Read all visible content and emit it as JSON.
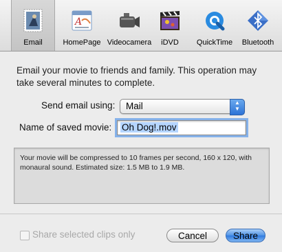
{
  "toolbar": {
    "items": [
      {
        "label": "Email",
        "icon": "email-stamp-icon",
        "selected": true
      },
      {
        "label": "HomePage",
        "icon": "homepage-icon",
        "selected": false
      },
      {
        "label": "Videocamera",
        "icon": "videocamera-icon",
        "selected": false
      },
      {
        "label": "iDVD",
        "icon": "idvd-clapboard-icon",
        "selected": false
      },
      {
        "label": "QuickTime",
        "icon": "quicktime-icon",
        "selected": false
      },
      {
        "label": "Bluetooth",
        "icon": "bluetooth-icon",
        "selected": false
      }
    ]
  },
  "main": {
    "description": "Email your movie to friends and family. This operation may take several minutes to complete.",
    "send_label": "Send email using:",
    "send_value": "Mail",
    "name_label": "Name of saved movie:",
    "name_value": "Oh Dog!.mov",
    "info": "Your movie will be compressed to 10 frames per second, 160 x 120, with monaural sound. Estimated size: 1.5 MB to 1.9 MB."
  },
  "footer": {
    "share_clips_label": "Share selected clips only",
    "share_clips_checked": false,
    "cancel_label": "Cancel",
    "share_label": "Share"
  },
  "colors": {
    "accent": "#4f93e6",
    "selection": "#b5d5ff",
    "focus_ring": "#86b2ea"
  }
}
